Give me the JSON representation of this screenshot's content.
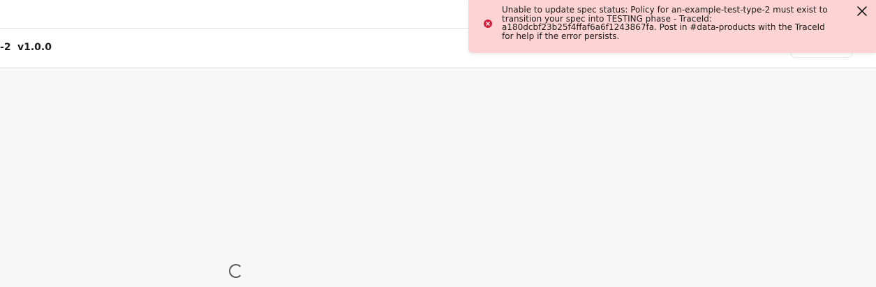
{
  "header": {
    "spec_name_fragment": "-2",
    "spec_version": "v1.0.0"
  },
  "toast": {
    "type": "error",
    "message": "Unable to update spec status: Policy for an-example-test-type-2 must exist to transition your spec into TESTING phase - TraceId: a180dcbf23b25f4ffaf6a6f1243867fa. Post in #data-products with the TraceId for help if the error persists.",
    "icon": "error-circle-icon",
    "close_icon": "close-icon",
    "colors": {
      "background": "#fdd3d3",
      "icon": "#d1243c"
    }
  },
  "loading": {
    "icon": "loading-spinner-icon"
  }
}
